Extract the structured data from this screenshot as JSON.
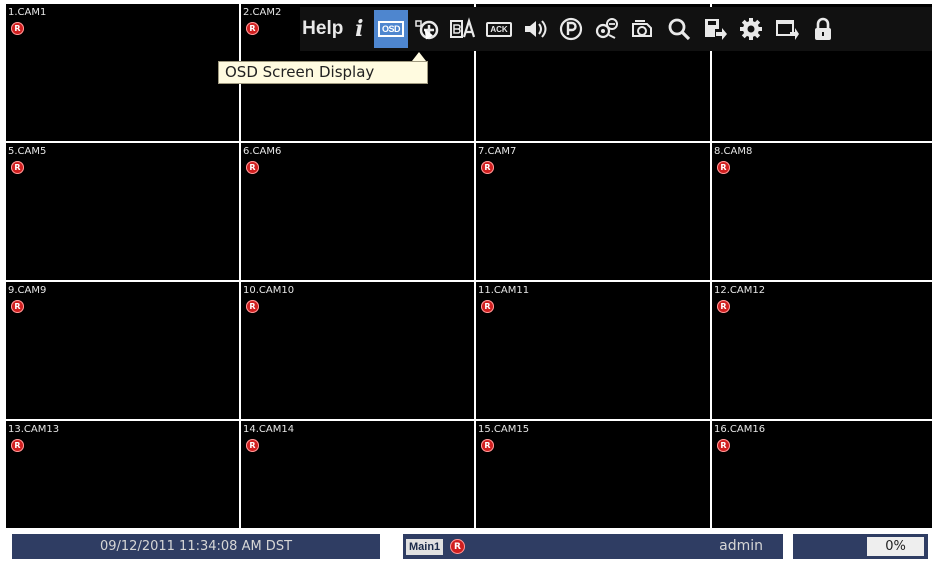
{
  "cameras": [
    {
      "label": "1.CAM1",
      "rec": "R"
    },
    {
      "label": "2.CAM2",
      "rec": "R"
    },
    {
      "label": "",
      "rec": ""
    },
    {
      "label": "",
      "rec": ""
    },
    {
      "label": "5.CAM5",
      "rec": "R"
    },
    {
      "label": "6.CAM6",
      "rec": "R"
    },
    {
      "label": "7.CAM7",
      "rec": "R"
    },
    {
      "label": "8.CAM8",
      "rec": "R"
    },
    {
      "label": "9.CAM9",
      "rec": "R"
    },
    {
      "label": "10.CAM10",
      "rec": "R"
    },
    {
      "label": "11.CAM11",
      "rec": "R"
    },
    {
      "label": "12.CAM12",
      "rec": "R"
    },
    {
      "label": "13.CAM13",
      "rec": "R"
    },
    {
      "label": "14.CAM14",
      "rec": "R"
    },
    {
      "label": "15.CAM15",
      "rec": "R"
    },
    {
      "label": "16.CAM16",
      "rec": "R"
    }
  ],
  "toolbar": {
    "help_label": "Help",
    "info_label": "i",
    "osd_label": "OSD",
    "ack_label": "ACK",
    "active_color": "#4e86cf",
    "icons": [
      "help",
      "info-icon",
      "osd-icon",
      "zoom-in-icon",
      "ab-compare-icon",
      "alarm-ack-icon",
      "speaker-icon",
      "ptz-icon",
      "camera-group-icon",
      "sequence-icon",
      "search-icon",
      "export-icon",
      "gear-icon",
      "layout-icon",
      "lock-icon"
    ]
  },
  "tooltip": {
    "text": "OSD Screen Display"
  },
  "status_bar": {
    "datetime": "09/12/2011 11:34:08 AM DST",
    "main_label": "Main1",
    "rec": "R",
    "user": "admin",
    "percent": "0%",
    "panel_color": "#2f3d63"
  }
}
